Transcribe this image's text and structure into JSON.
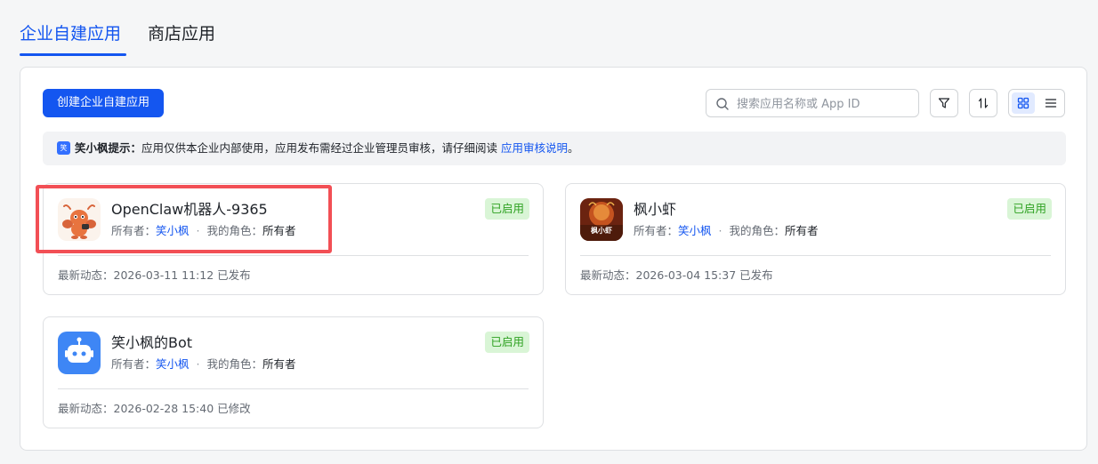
{
  "tabs": [
    {
      "label": "企业自建应用",
      "active": true
    },
    {
      "label": "商店应用",
      "active": false
    }
  ],
  "toolbar": {
    "create_label": "创建企业自建应用",
    "search_placeholder": "搜索应用名称或 App ID",
    "filter_icon": "filter-icon",
    "sort_icon": "sort-icon",
    "grid_icon": "grid-view-icon",
    "list_icon": "list-view-icon"
  },
  "notice": {
    "icon_text": "笑",
    "title": "笑小枫提示：",
    "text": "应用仅供本企业内部使用，应用发布需经过企业管理员审核，请仔细阅读 ",
    "link": "应用审核说明",
    "suffix": "。"
  },
  "labels": {
    "owner": "所有者：",
    "role": "我的角色：",
    "activity": "最新动态："
  },
  "apps": [
    {
      "name": "OpenClaw机器人-9365",
      "owner": "笑小枫",
      "role": "所有者",
      "status": "已启用",
      "activity": "2026-03-11 11:12 已发布",
      "icon": "lobster-avatar-icon"
    },
    {
      "name": "枫小虾",
      "owner": "笑小枫",
      "role": "所有者",
      "status": "已启用",
      "activity": "2026-03-04 15:37 已发布",
      "icon": "shrimp-avatar-icon",
      "icon_text": "枫小虾"
    },
    {
      "name": "笑小枫的Bot",
      "owner": "笑小枫",
      "role": "所有者",
      "status": "已启用",
      "activity": "2026-02-28 15:40 已修改",
      "icon": "robot-icon"
    }
  ],
  "colors": {
    "accent": "#1456f0",
    "status_bg": "#d9f5d6",
    "status_text": "#2ea121",
    "highlight": "#f24f55"
  }
}
